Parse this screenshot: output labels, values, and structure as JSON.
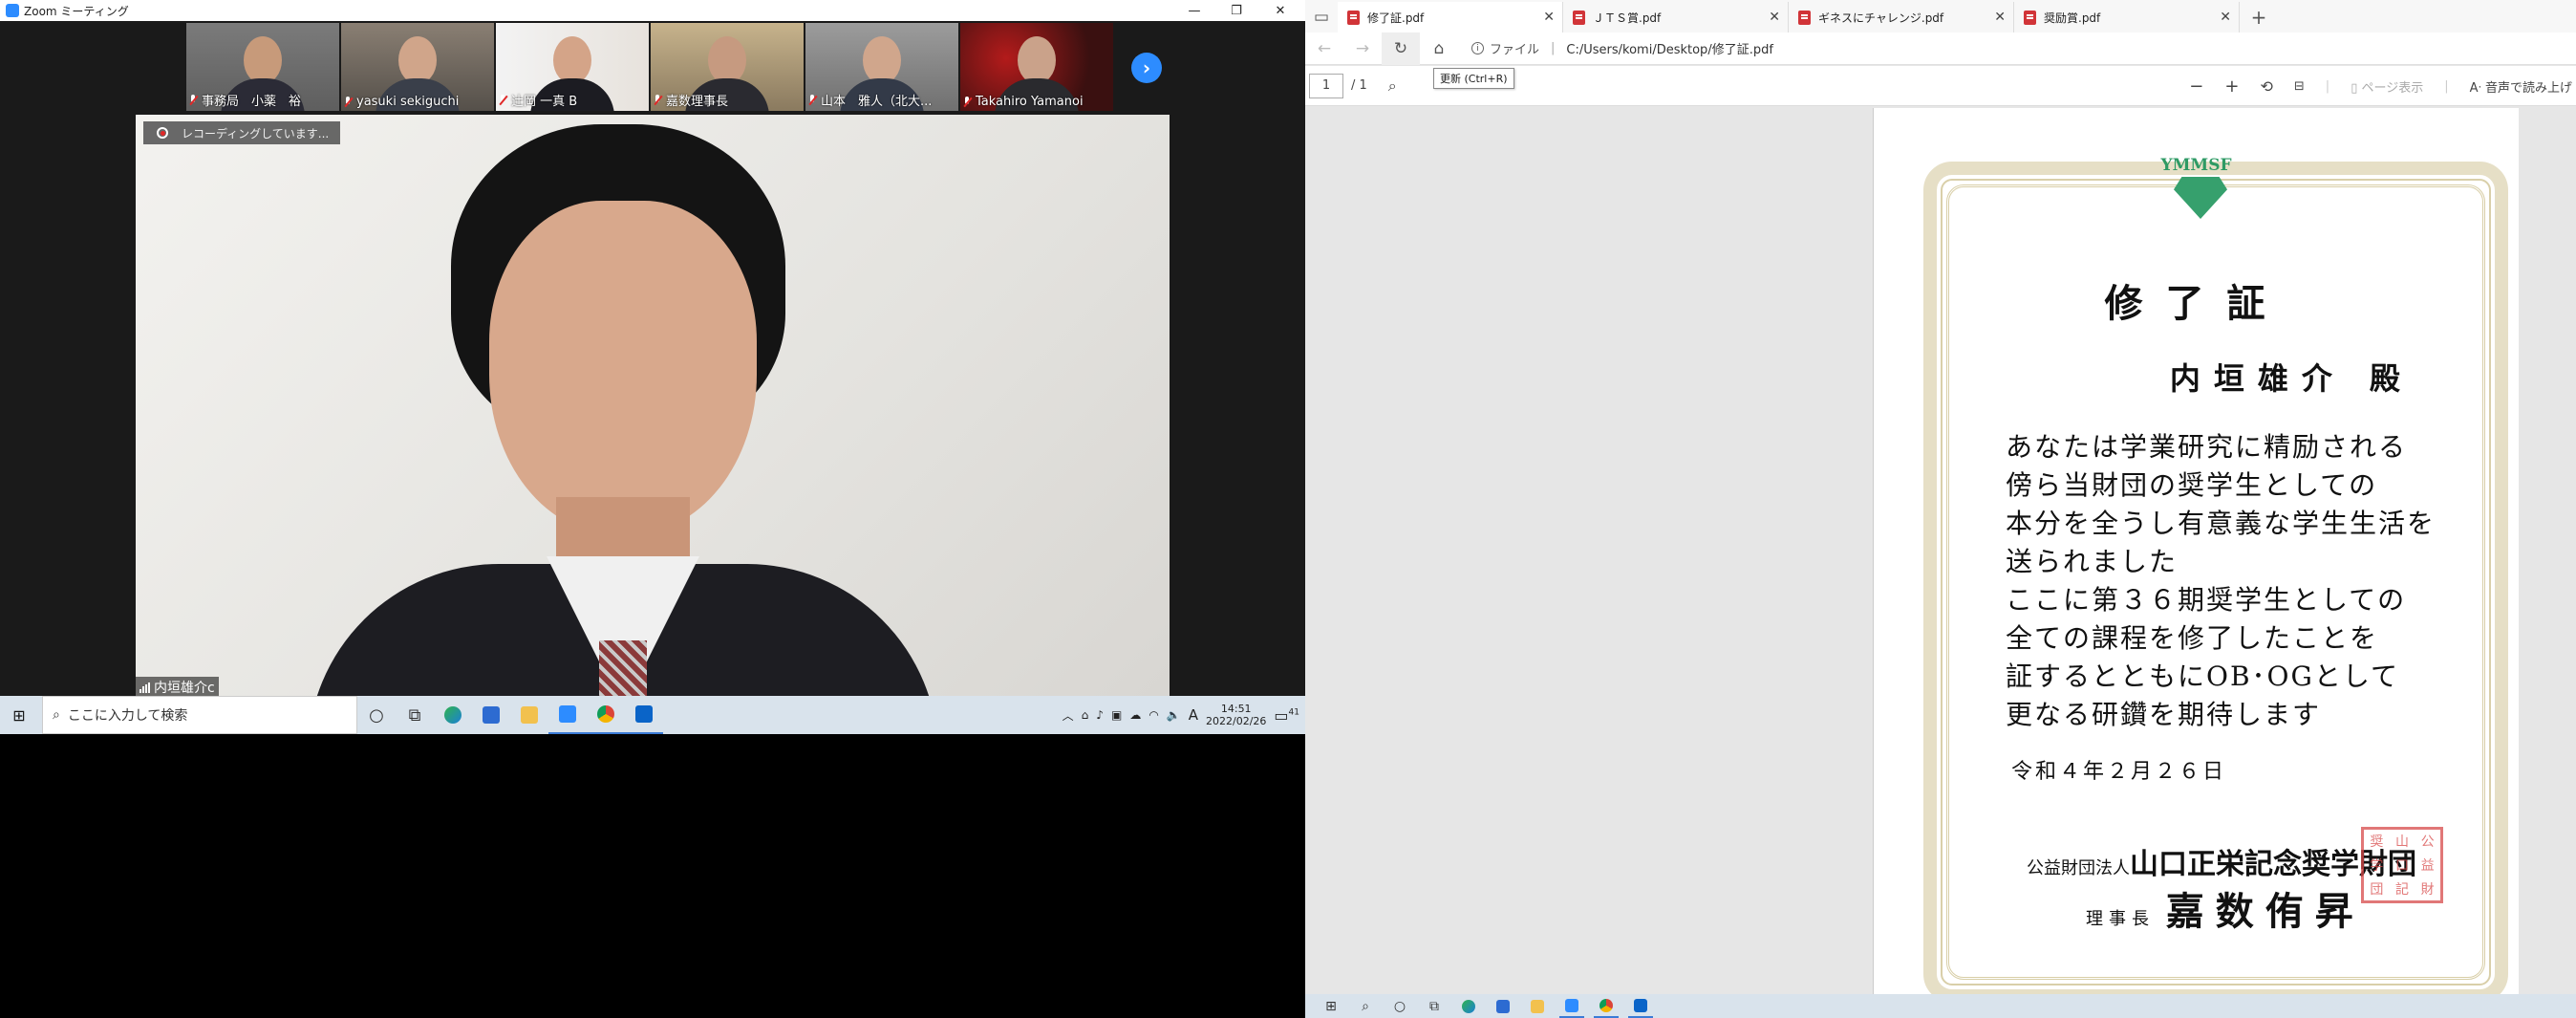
{
  "zoom": {
    "title": "Zoom ミーティング",
    "participants": [
      {
        "name": "事務局　小薬　裕"
      },
      {
        "name": "yasuki sekiguchi"
      },
      {
        "name": "辻岡 一真 B"
      },
      {
        "name": "嘉数理事長"
      },
      {
        "name": "山本　雅人（北大..."
      },
      {
        "name": "Takahiro Yamanoi"
      }
    ],
    "recording_text": "レコーディングしています...",
    "speaker_name": "内垣雄介c"
  },
  "taskbar_left": {
    "search_placeholder": "ここに入力して検索",
    "time": "14:51",
    "date": "2022/02/26",
    "ime": "A",
    "notification_count": "41"
  },
  "edge": {
    "tabs": [
      {
        "label": "修了証.pdf",
        "active": true
      },
      {
        "label": "ＪＴＳ賞.pdf",
        "active": false
      },
      {
        "label": "ギネスにチャレンジ.pdf",
        "active": false
      },
      {
        "label": "奨励賞.pdf",
        "active": false
      }
    ],
    "url_scheme": "ファイル",
    "url": "C:/Users/komi/Desktop/修了証.pdf",
    "tooltip": "更新 (Ctrl+R)",
    "page_current": "1",
    "page_total": "/ 1",
    "page_view_label": "ページ表示",
    "read_aloud_label": "音声で読み上げ"
  },
  "certificate": {
    "logo_text": "YMMSF",
    "title": "修了証",
    "recipient": "内垣雄介 殿",
    "lines": [
      "あなたは学業研究に精励される",
      "傍ら当財団の奨学生としての",
      "本分を全うし有意義な学生生活を",
      "送られました",
      "ここに第３６期奨学生としての",
      "全ての課程を修了したことを",
      "証するとともにOB･OGとして",
      "更なる研鑽を期待します"
    ],
    "date": "令和４年２月２６日",
    "org_prefix": "公益財団法人",
    "org_name": "山口正栄記念奨学財団",
    "signer_title": "理事長",
    "signer_name": "嘉数侑昇"
  }
}
